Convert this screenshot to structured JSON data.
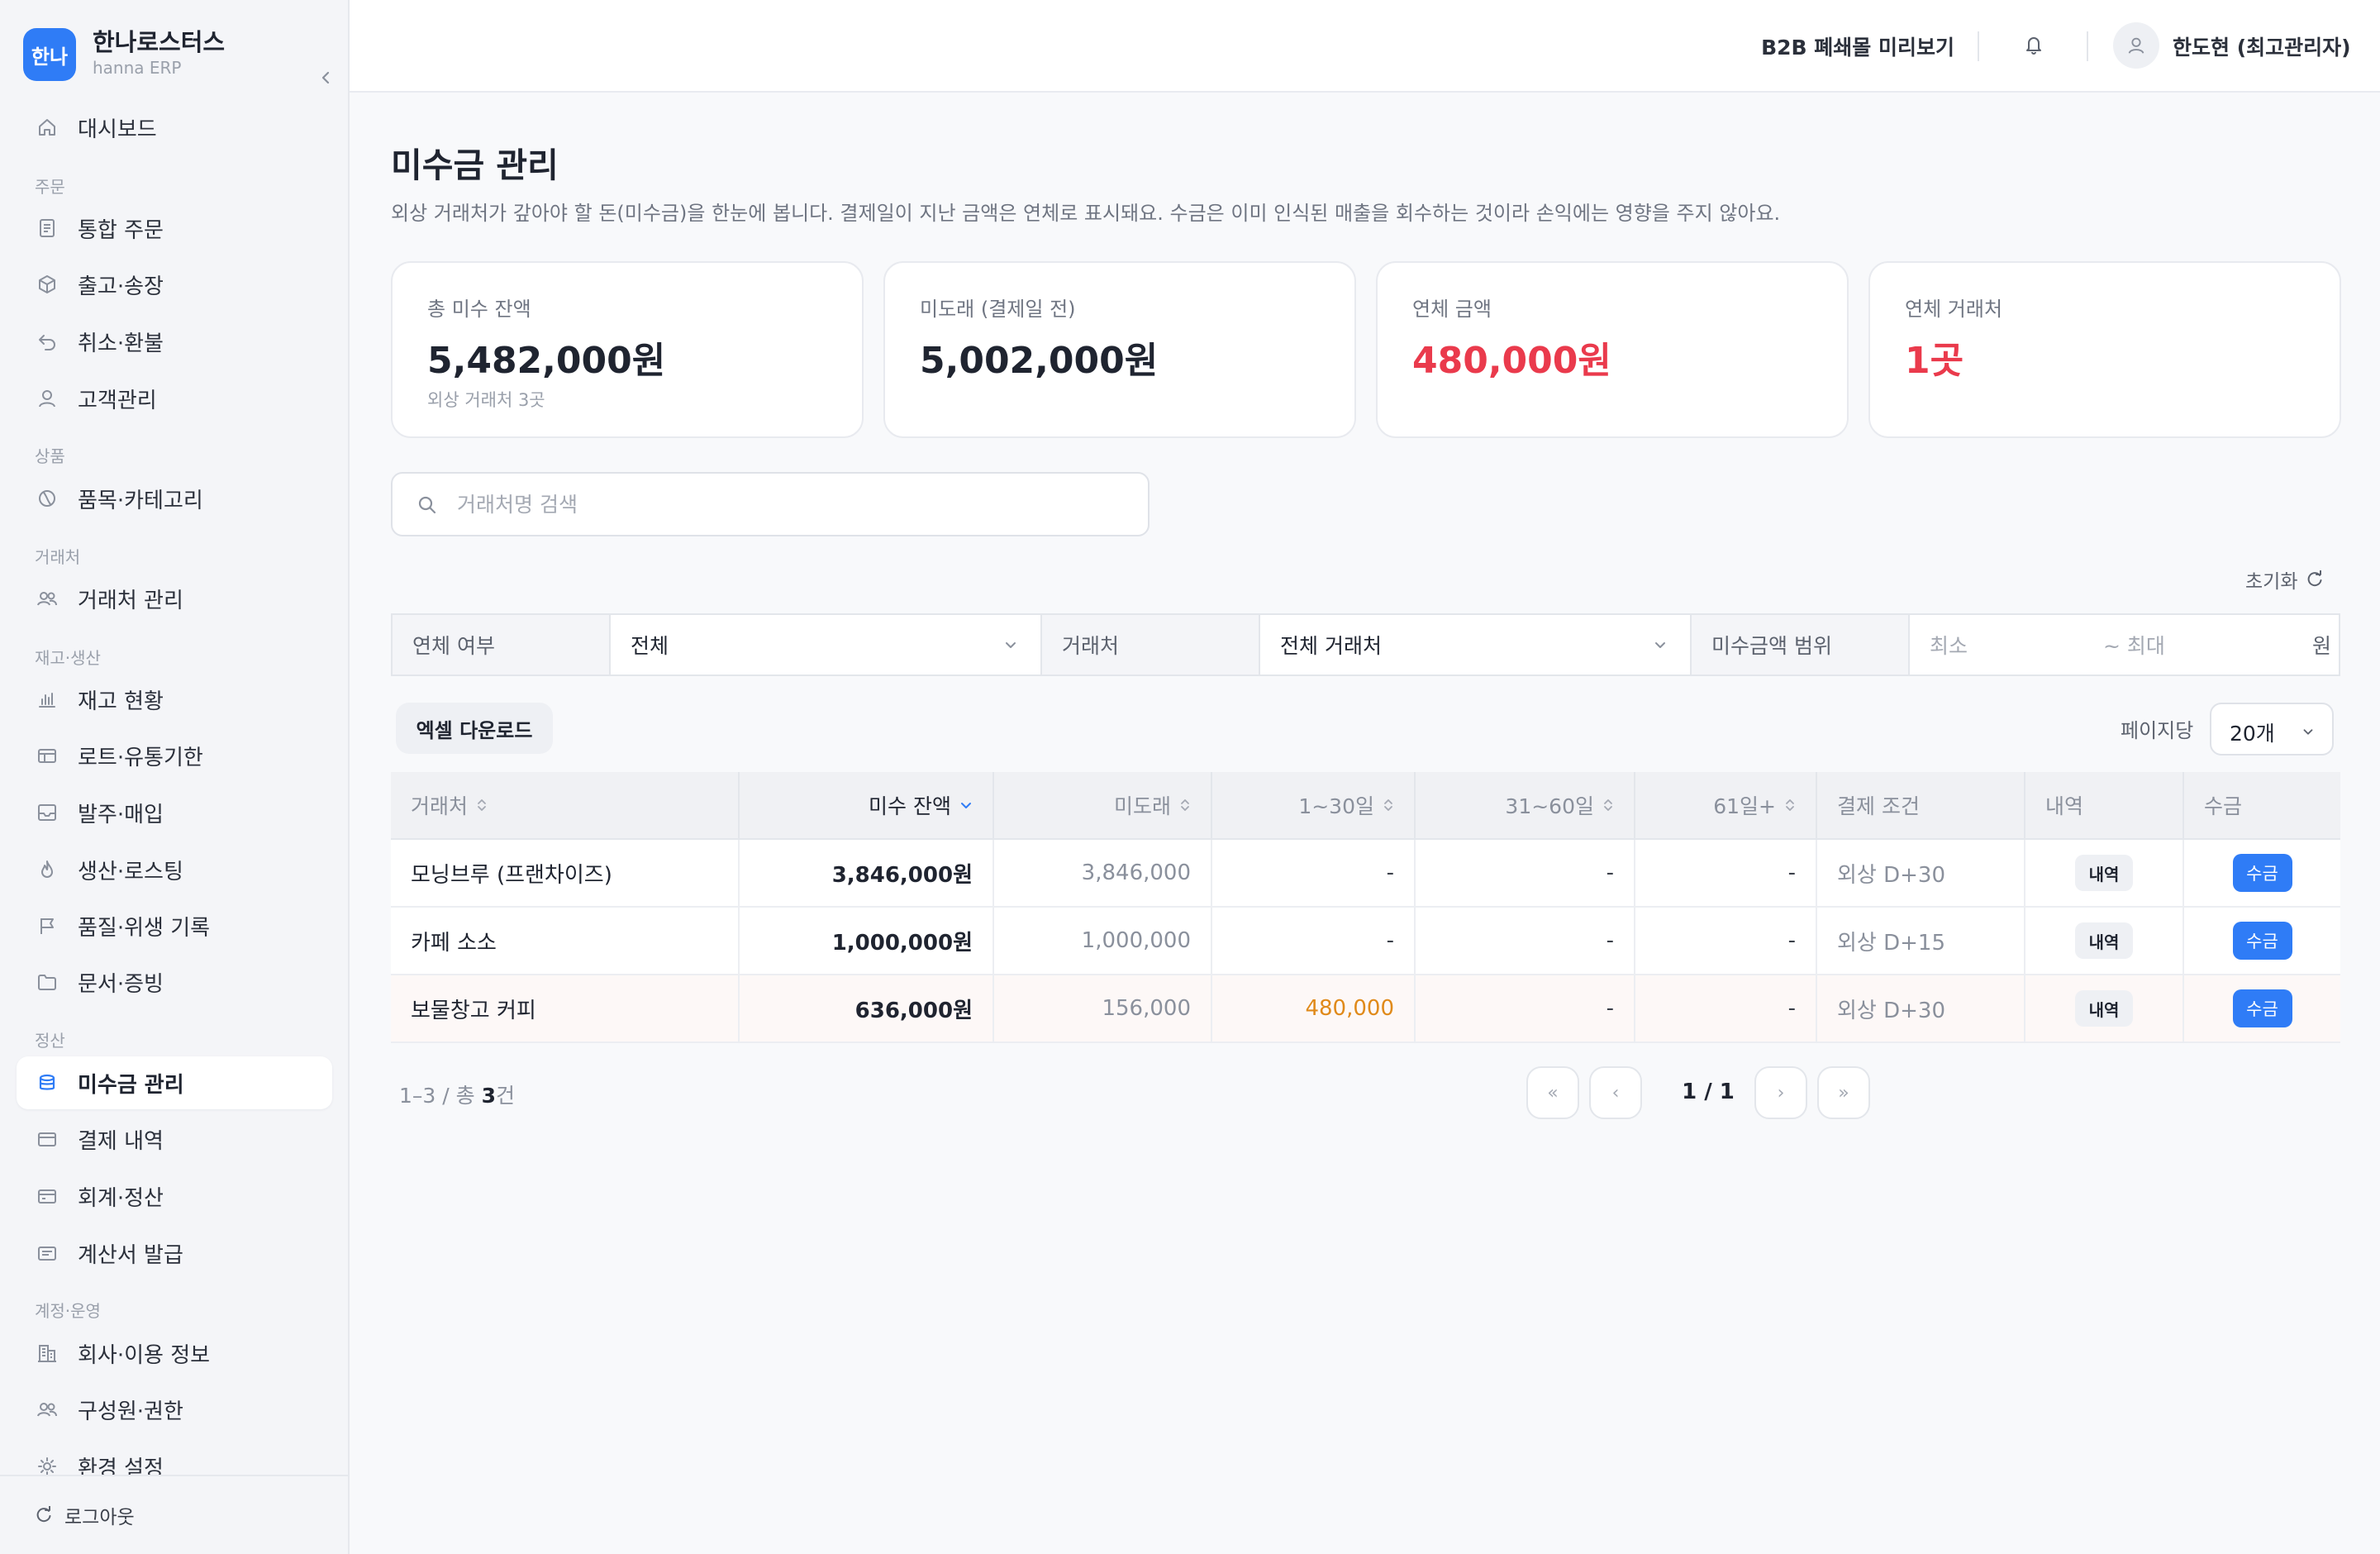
{
  "brand": {
    "logo_text": "한나",
    "name": "한나로스터스",
    "sub": "hanna ERP"
  },
  "nav": {
    "dashboard": "대시보드",
    "sections": {
      "order": "주문",
      "product": "상품",
      "partner": "거래처",
      "stock": "재고·생산",
      "settle": "정산",
      "account": "계정·운영"
    },
    "items": {
      "orders": "통합 주문",
      "shipping": "출고·송장",
      "refund": "취소·환불",
      "customers": "고객관리",
      "category": "품목·카테고리",
      "partners": "거래처 관리",
      "inventory": "재고 현황",
      "lots": "로트·유통기한",
      "purchase": "발주·매입",
      "production": "생산·로스팅",
      "quality": "품질·위생 기록",
      "documents": "문서·증빙",
      "receivables": "미수금 관리",
      "payments": "결제 내역",
      "accounting": "회계·정산",
      "invoice": "계산서 발급",
      "company": "회사·이용 정보",
      "members": "구성원·권한",
      "settings": "환경 설정"
    },
    "logout": "로그아웃"
  },
  "topbar": {
    "b2b_preview": "B2B 폐쇄몰 미리보기",
    "user": "한도현 (최고관리자)"
  },
  "page": {
    "title": "미수금 관리",
    "desc": "외상 거래처가 갚아야 할 돈(미수금)을 한눈에 봅니다. 결제일이 지난 금액은 연체로 표시돼요. 수금은 이미 인식된 매출을 회수하는 것이라 손익에는 영향을 주지 않아요."
  },
  "cards": [
    {
      "label": "총 미수 잔액",
      "value": "5,482,000원",
      "sub": "외상 거래처 3곳"
    },
    {
      "label": "미도래 (결제일 전)",
      "value": "5,002,000원"
    },
    {
      "label": "연체 금액",
      "value": "480,000원"
    },
    {
      "label": "연체 거래처",
      "value": "1곳"
    }
  ],
  "search": {
    "placeholder": "거래처명 검색"
  },
  "reset_label": "초기화",
  "filters": {
    "overdue_label": "연체 여부",
    "overdue_value": "전체",
    "partner_label": "거래처",
    "partner_value": "전체 거래처",
    "range_label": "미수금액 범위",
    "min_placeholder": "최소",
    "max_placeholder": "~ 최대",
    "unit": "원"
  },
  "toolbar": {
    "excel": "엑셀 다운로드",
    "per_page_label": "페이지당",
    "per_page_value": "20개"
  },
  "table": {
    "headers": {
      "partner": "거래처",
      "balance": "미수 잔액",
      "not_due": "미도래",
      "d1_30": "1~30일",
      "d31_60": "31~60일",
      "d61": "61일+",
      "terms": "결제 조건",
      "history": "내역",
      "collect": "수금"
    },
    "rows": [
      {
        "partner": "모닝브루 (프랜차이즈)",
        "balance": "3,846,000원",
        "not_due": "3,846,000",
        "d1_30": "-",
        "d31_60": "-",
        "d61": "-",
        "terms": "외상 D+30",
        "history": "내역",
        "collect": "수금"
      },
      {
        "partner": "카페 소소",
        "balance": "1,000,000원",
        "not_due": "1,000,000",
        "d1_30": "-",
        "d31_60": "-",
        "d61": "-",
        "terms": "외상 D+15",
        "history": "내역",
        "collect": "수금"
      },
      {
        "partner": "보물창고 커피",
        "balance": "636,000원",
        "not_due": "156,000",
        "d1_30": "480,000",
        "d31_60": "-",
        "d61": "-",
        "terms": "외상 D+30",
        "history": "내역",
        "collect": "수금"
      }
    ]
  },
  "pagination": {
    "range": "1–3 / 총 ",
    "total": "3",
    "suffix": "건",
    "page": "1 / 1",
    "first": "«",
    "prev": "‹",
    "next": "›",
    "last": "»"
  },
  "colors": {
    "accent": "#2f7cf6",
    "danger": "#ea3a4c",
    "warning": "#e08a1a"
  },
  "icons": {
    "dashboard": "home-icon",
    "orders": "document-icon",
    "shipping": "box-icon",
    "refund": "undo-icon",
    "customers": "user-icon",
    "category": "tag-icon",
    "partners": "users-icon",
    "inventory": "bar-chart-icon",
    "lots": "table-icon",
    "purchase": "inbox-icon",
    "production": "flame-icon",
    "quality": "flag-icon",
    "documents": "folder-icon",
    "receivables": "database-icon",
    "payments": "card-icon",
    "accounting": "card-icon",
    "invoice": "invoice-icon",
    "company": "building-icon",
    "members": "users-icon",
    "settings": "sun-icon"
  }
}
